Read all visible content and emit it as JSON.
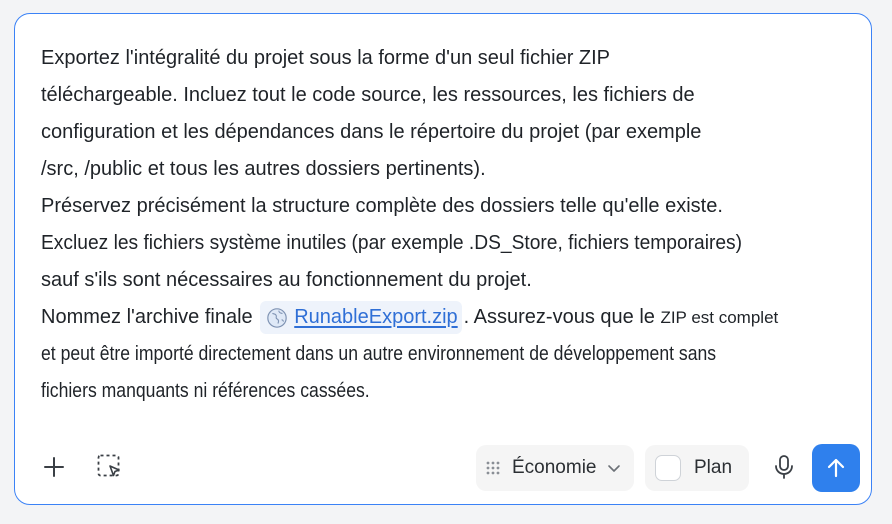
{
  "prompt": {
    "line1": "Exportez l'intégralité du projet sous la forme d'un seul fichier ZIP",
    "line2": "téléchargeable. Incluez tout le code source, les ressources, les fichiers de",
    "line3": "configuration et les dépendances dans le répertoire du projet (par exemple",
    "line4": "/src, /public et tous les autres dossiers pertinents).",
    "line5": "Préservez précisément la structure complète des dossiers telle qu'elle existe.",
    "line6": "Excluez les fichiers système inutiles (par exemple .DS_Store, fichiers temporaires)",
    "line7": "sauf s'ils sont nécessaires au fonctionnement du projet.",
    "line8_before": "Nommez l'archive finale",
    "file_chip_label": "RunableExport.zip",
    "line8_after": ". Assurez-vous que le",
    "line8_small": "ZIP est complet",
    "line9": "et peut être importé directement dans un autre environnement de développement sans",
    "line10": "fichiers manquants ni références cassées."
  },
  "toolbar": {
    "mode_label": "Économie",
    "plan_label": "Plan"
  },
  "icons": {
    "add": "plus-icon",
    "select": "selection-cursor-icon",
    "file": "globe-icon",
    "mode": "grip-icon",
    "dropdown": "chevron-down-icon",
    "mic": "microphone-icon",
    "send": "arrow-up-icon"
  },
  "colors": {
    "border_accent": "#3b82f6",
    "send_button": "#2f80ed",
    "link": "#2f6fd6"
  }
}
